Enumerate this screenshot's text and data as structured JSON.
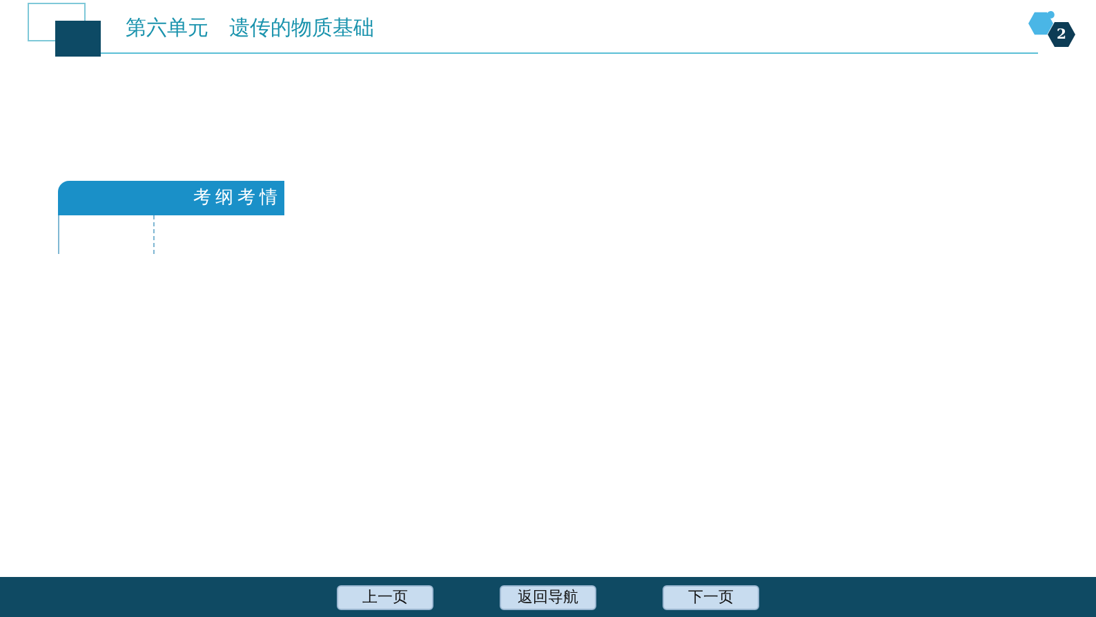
{
  "header": {
    "title": "第六单元　遗传的物质基础",
    "page_number": "2"
  },
  "card": {
    "title": "考纲考情"
  },
  "nav_buttons": [
    {
      "label": "上一页"
    },
    {
      "label": "返回导航"
    },
    {
      "label": "下一页"
    }
  ]
}
